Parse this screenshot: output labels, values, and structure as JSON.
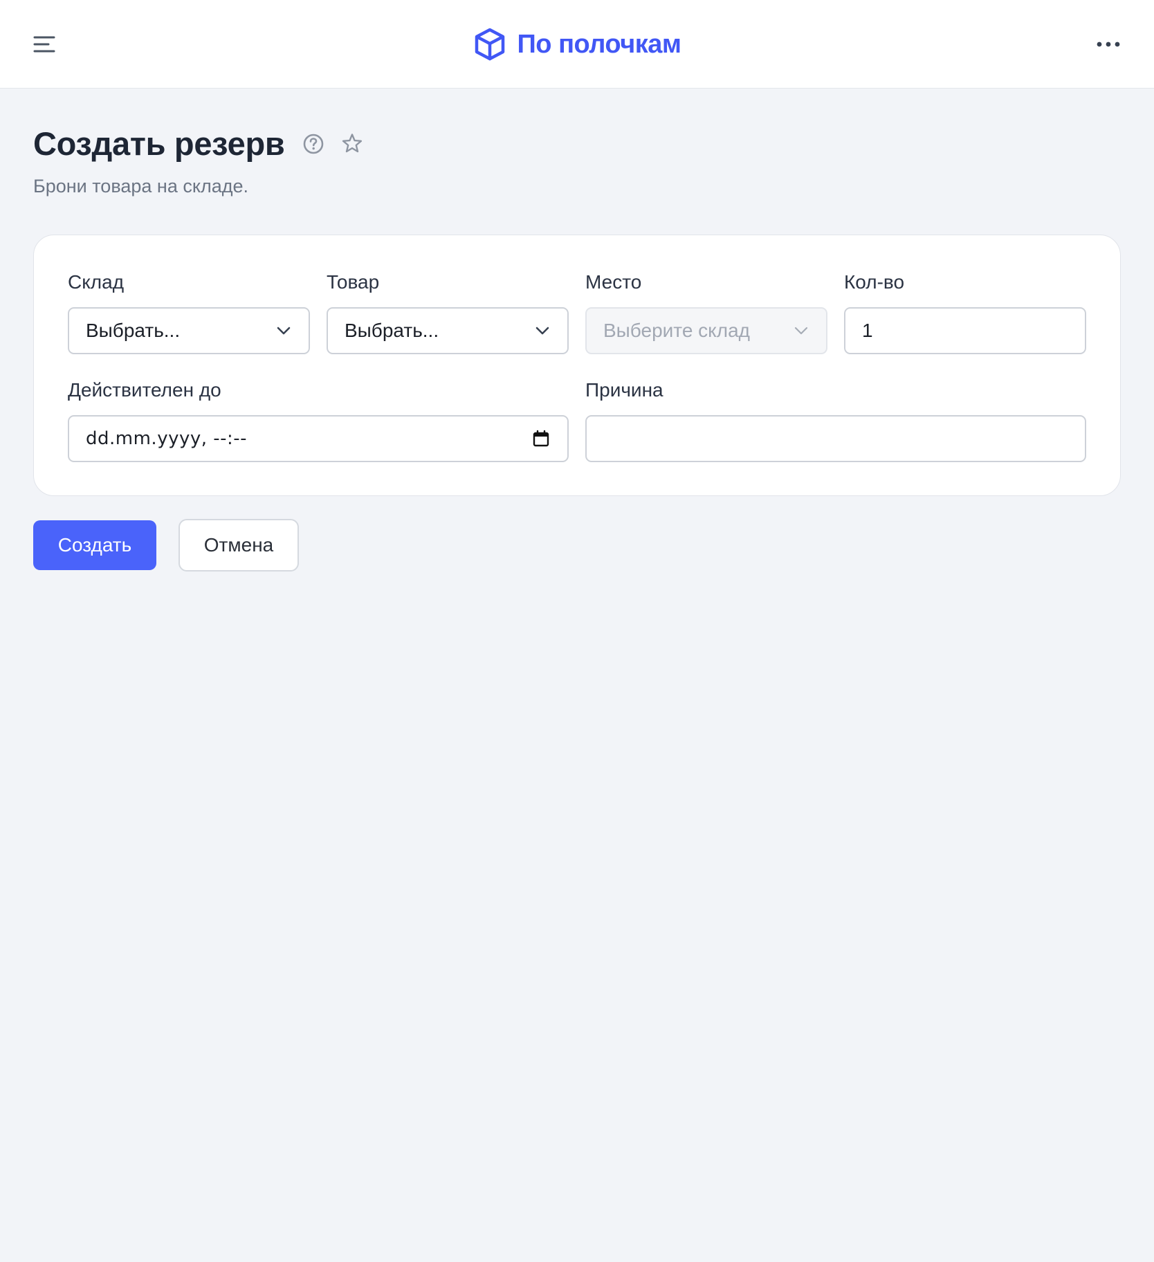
{
  "app": {
    "brand_name": "По полочкам",
    "brand_color": "#4157f5"
  },
  "page": {
    "title": "Создать резерв",
    "subtitle": "Брони товара на складе."
  },
  "form": {
    "warehouse": {
      "label": "Склад",
      "value": "Выбрать..."
    },
    "product": {
      "label": "Товар",
      "value": "Выбрать..."
    },
    "location": {
      "label": "Место",
      "placeholder": "Выберите склад",
      "disabled": true
    },
    "quantity": {
      "label": "Кол-во",
      "value": "1"
    },
    "valid_until": {
      "label": "Действителен до",
      "placeholder": "dd.mm.yyyy, --:--"
    },
    "reason": {
      "label": "Причина",
      "value": ""
    }
  },
  "actions": {
    "create_label": "Создать",
    "cancel_label": "Отмена",
    "primary_color": "#4a63fa"
  },
  "icons": {
    "menu": "hamburger-menu-icon",
    "logo": "cube-icon",
    "more": "more-horizontal-icon",
    "help": "question-circle-icon",
    "favorite": "star-outline-icon",
    "dropdown": "chevron-down-icon",
    "calendar": "calendar-icon"
  }
}
